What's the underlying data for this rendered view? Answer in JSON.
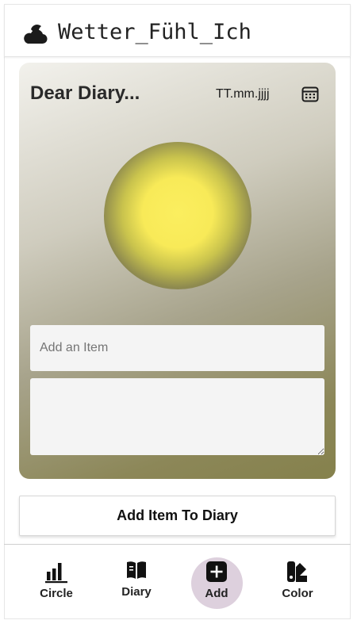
{
  "app": {
    "title": "Wetter_Fühl_Ich",
    "logo_icon": "cloud-moon-icon"
  },
  "card": {
    "title": "Dear Diary...",
    "date_placeholder": "TT.mm.jjjj",
    "calendar_icon": "calendar-icon",
    "gradient_colors": [
      "#f2f1ec",
      "#a7a38b",
      "#85814c"
    ]
  },
  "mood_orb": {
    "core_color": "#fbee5f",
    "edge_color": "#6e6b5f"
  },
  "form": {
    "item_placeholder": "Add an Item",
    "item_value": "",
    "notes_value": "",
    "submit_label": "Add Item To Diary"
  },
  "nav": {
    "items": [
      {
        "label": "Circle",
        "icon": "bar-chart-icon"
      },
      {
        "label": "Diary",
        "icon": "book-icon"
      },
      {
        "label": "Add",
        "icon": "plus-square-icon",
        "active": true
      },
      {
        "label": "Color",
        "icon": "palette-icon"
      }
    ],
    "active_color": "#ddd0dd"
  }
}
